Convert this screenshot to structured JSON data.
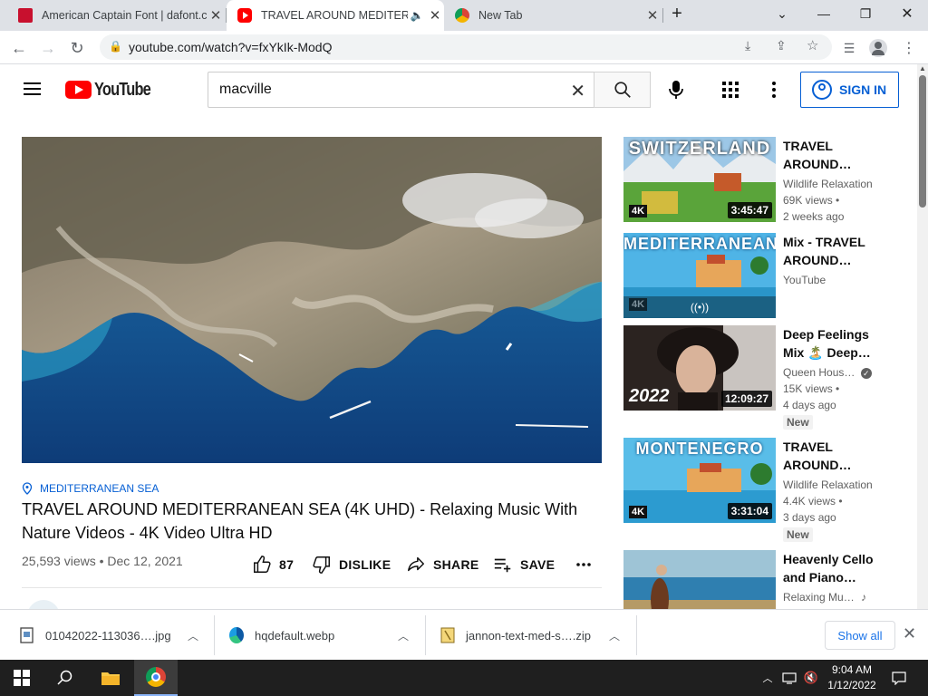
{
  "browser": {
    "tabs": [
      {
        "title": "American Captain Font | dafont.c",
        "active": false
      },
      {
        "title": "TRAVEL AROUND MEDITERR",
        "active": true
      },
      {
        "title": "New Tab",
        "active": false
      }
    ],
    "url": "youtube.com/watch?v=fxYkIk-ModQ"
  },
  "youtube": {
    "logo_text": "YouTube",
    "search_value": "macville",
    "signin_label": "SIGN IN"
  },
  "video": {
    "hashtag": "MEDITERRANEAN SEA",
    "title": "TRAVEL AROUND MEDITERRANEAN SEA (4K UHD) - Relaxing Music With Nature Videos - 4K Video Ultra HD",
    "meta": "25,593 views • Dec 12, 2021",
    "likes": "87",
    "dislike_label": "DISLIKE",
    "share_label": "SHARE",
    "save_label": "SAVE"
  },
  "recommendations": [
    {
      "title": "TRAVEL AROUND…",
      "channel": "Wildlife Relaxation",
      "views": "69K views •",
      "age": "2 weeks ago",
      "duration": "3:45:47",
      "overlay": "SWITZERLAND",
      "badge": ""
    },
    {
      "title": "Mix - TRAVEL AROUND…",
      "channel": "YouTube",
      "views": "",
      "age": "",
      "duration": "",
      "overlay": "MEDITERRANEAN",
      "badge": ""
    },
    {
      "title": "Deep Feelings Mix 🏝️ Deep…",
      "channel": "Queen Hous…",
      "views": "15K views •",
      "age": "4 days ago",
      "duration": "12:09:27",
      "overlay": "2022",
      "badge": "New"
    },
    {
      "title": "TRAVEL AROUND…",
      "channel": "Wildlife Relaxation",
      "views": "4.4K views •",
      "age": "3 days ago",
      "duration": "3:31:04",
      "overlay": "MONTENEGRO",
      "badge": "New"
    },
    {
      "title": "Heavenly Cello and Piano…",
      "channel": "Relaxing Mu…",
      "views": "",
      "age": "",
      "duration": "",
      "overlay": "",
      "badge": ""
    }
  ],
  "downloads": {
    "items": [
      {
        "name": "01042022-113036….jpg"
      },
      {
        "name": "hqdefault.webp"
      },
      {
        "name": "jannon-text-med-s….zip"
      }
    ],
    "show_all": "Show all"
  },
  "taskbar": {
    "time": "9:04 AM",
    "date": "1/12/2022"
  },
  "colors": {
    "youtube_red": "#ff0000",
    "link_blue": "#065fd4",
    "chrome_strip": "#dee1e6"
  }
}
